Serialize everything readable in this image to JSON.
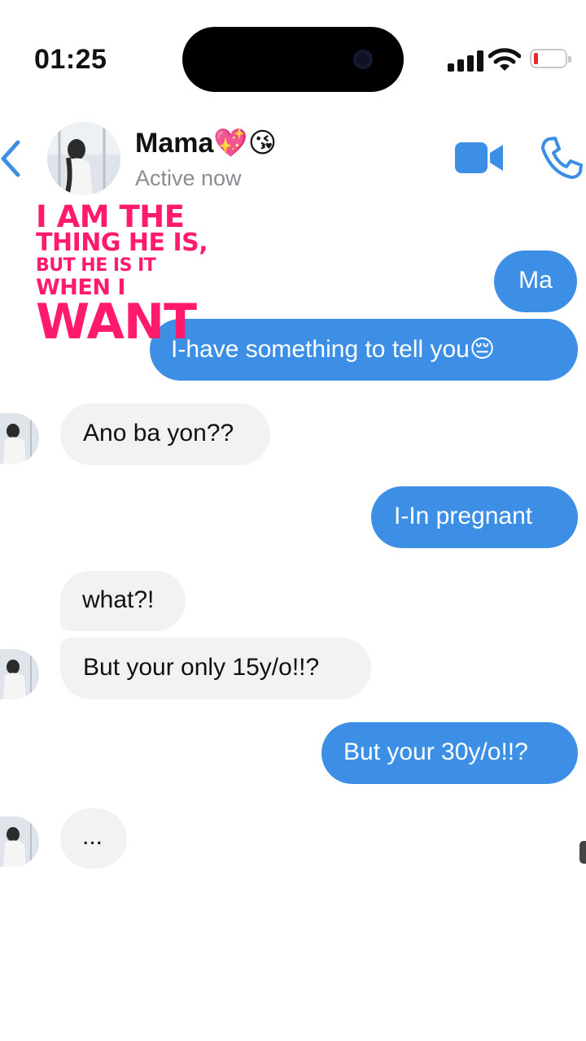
{
  "status_bar": {
    "time": "01:25",
    "battery_color": "#e52b2b"
  },
  "header": {
    "name": "Mama💖😘",
    "status": "Active now",
    "accent": "#3d8fe6",
    "icons": [
      "chevron-left-icon",
      "video-call-icon",
      "phone-icon"
    ]
  },
  "overlay": {
    "color": "#ff1a6e",
    "lines": [
      "I AM THE",
      "THING HE IS,",
      "BUT HE IS IT",
      "WHEN I",
      "WANT"
    ]
  },
  "messages": [
    {
      "from": "me",
      "text": "Ma"
    },
    {
      "from": "me",
      "text": "I-have something to tell you😔"
    },
    {
      "from": "them",
      "text": "Ano ba yon??"
    },
    {
      "from": "me",
      "text": "I-In pregnant"
    },
    {
      "from": "them",
      "text": "what?!"
    },
    {
      "from": "them",
      "text": "But your only 15y/o!!?"
    },
    {
      "from": "me",
      "text": "But your 30y/o!!?"
    },
    {
      "from": "them",
      "text": "..."
    }
  ]
}
